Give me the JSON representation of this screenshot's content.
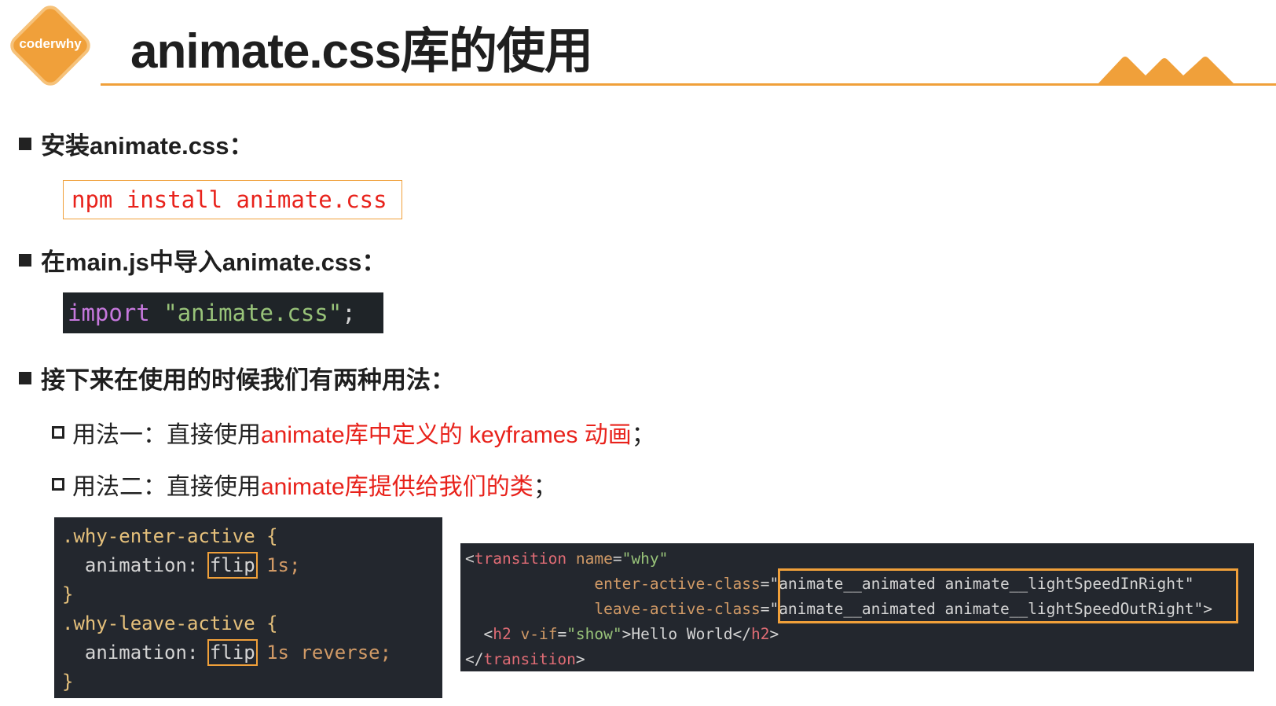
{
  "header": {
    "logo_text": "coderwhy",
    "title": "animate.css库的使用",
    "accent_color": "#f0a03a"
  },
  "section1": {
    "heading": "安装animate.css：",
    "command": "npm install animate.css"
  },
  "section2": {
    "heading": "在main.js中导入animate.css：",
    "import_keyword": "import",
    "import_string": "\"animate.css\"",
    "import_semicolon": ";"
  },
  "section3": {
    "heading": "接下来在使用的时候我们有两种用法：",
    "usage1_prefix": "用法一：直接使用",
    "usage1_highlight": "animate库中定义的 keyframes 动画",
    "usage1_suffix": "；",
    "usage2_prefix": "用法二：直接使用",
    "usage2_highlight": "animate库提供给我们的类",
    "usage2_suffix": "；"
  },
  "code_css": {
    "line1_selector": ".why-enter-active",
    "line1_brace": "{",
    "line2_prop": "animation:",
    "line2_name": "flip",
    "line2_rest": "1s;",
    "line3": "}",
    "line4_selector": ".why-leave-active",
    "line4_brace": "{",
    "line5_prop": "animation:",
    "line5_name": "flip",
    "line5_rest": "1s reverse;",
    "line6": "}"
  },
  "code_template": {
    "l1_open": "<",
    "l1_tag": "transition",
    "l1_attr": "name",
    "l1_val": "\"why\"",
    "l2_attr": "enter-active-class",
    "l2_val": "animate__animated animate__lightSpeedInRight\"",
    "l3_attr": "leave-active-class",
    "l3_val": "animate__animated animate__lightSpeedOutRight\"",
    "l4_tag_open": "h2",
    "l4_attr": "v-if",
    "l4_val": "\"show\"",
    "l4_text": "Hello World",
    "l4_tag_close": "h2",
    "l5_tag": "transition"
  },
  "icons": [
    "logo-diamond",
    "mountain-decoration",
    "square-bullet-icon",
    "hollow-square-bullet-icon"
  ]
}
